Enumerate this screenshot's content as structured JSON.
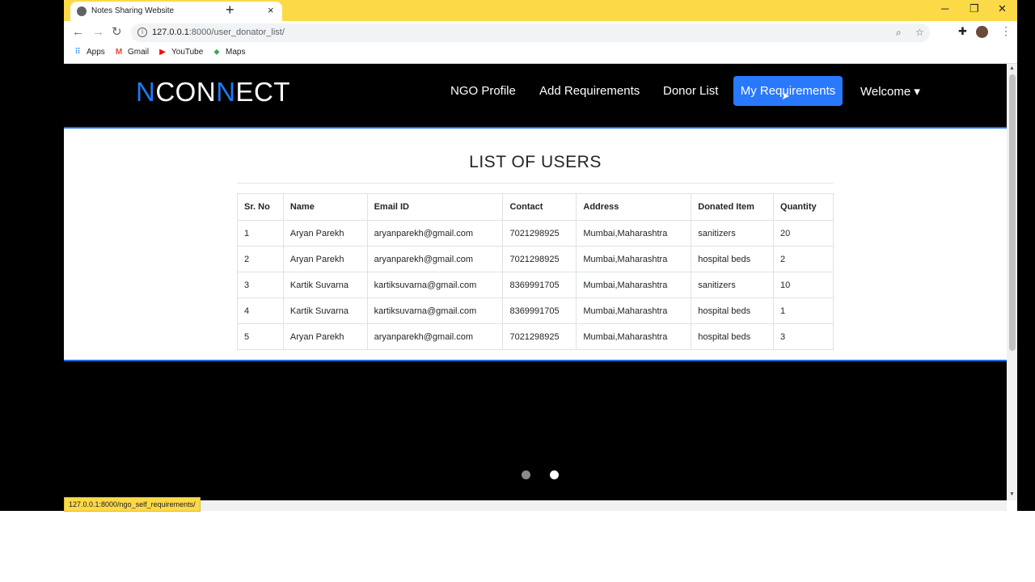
{
  "browser": {
    "tab_title": "Notes Sharing Website",
    "tab_close": "×",
    "new_tab": "+",
    "win_minimize": "─",
    "win_restore": "❐",
    "win_close": "✕",
    "url_host": "127.0.0.1",
    "url_path": ":8000/user_donator_list/",
    "bookmarks": [
      {
        "label": "Apps",
        "icon": "apps-grid-icon"
      },
      {
        "label": "Gmail",
        "icon": "gmail-icon"
      },
      {
        "label": "YouTube",
        "icon": "youtube-icon"
      },
      {
        "label": "Maps",
        "icon": "maps-icon"
      }
    ],
    "status_url": "127.0.0.1:8000/ngo_self_requirements/"
  },
  "navbar": {
    "brand_n1": "N",
    "brand_mid": "CON",
    "brand_n2": "N",
    "brand_end": "ECT",
    "links": [
      "NGO Profile",
      "Add Requirements",
      "Donor List"
    ],
    "active_link": "My Requirements",
    "welcome": "Welcome ▾"
  },
  "main": {
    "title": "LIST OF USERS",
    "table": {
      "headers": [
        "Sr. No",
        "Name",
        "Email ID",
        "Contact",
        "Address",
        "Donated Item",
        "Quantity"
      ],
      "rows": [
        [
          "1",
          "Aryan Parekh",
          "aryanparekh@gmail.com",
          "7021298925",
          "Mumbai,Maharashtra",
          "sanitizers",
          "20"
        ],
        [
          "2",
          "Aryan Parekh",
          "aryanparekh@gmail.com",
          "7021298925",
          "Mumbai,Maharashtra",
          "hospital beds",
          "2"
        ],
        [
          "3",
          "Kartik Suvarna",
          "kartiksuvarna@gmail.com",
          "8369991705",
          "Mumbai,Maharashtra",
          "sanitizers",
          "10"
        ],
        [
          "4",
          "Kartik Suvarna",
          "kartiksuvarna@gmail.com",
          "8369991705",
          "Mumbai,Maharashtra",
          "hospital beds",
          "1"
        ],
        [
          "5",
          "Aryan Parekh",
          "aryanparekh@gmail.com",
          "7021298925",
          "Mumbai,Maharashtra",
          "hospital beds",
          "3"
        ]
      ]
    }
  },
  "carousel": {
    "active_index": 1
  },
  "colors": {
    "accent": "#2979ff",
    "brand_blue": "#1e7bf5",
    "tabstrip": "#fcd947"
  }
}
